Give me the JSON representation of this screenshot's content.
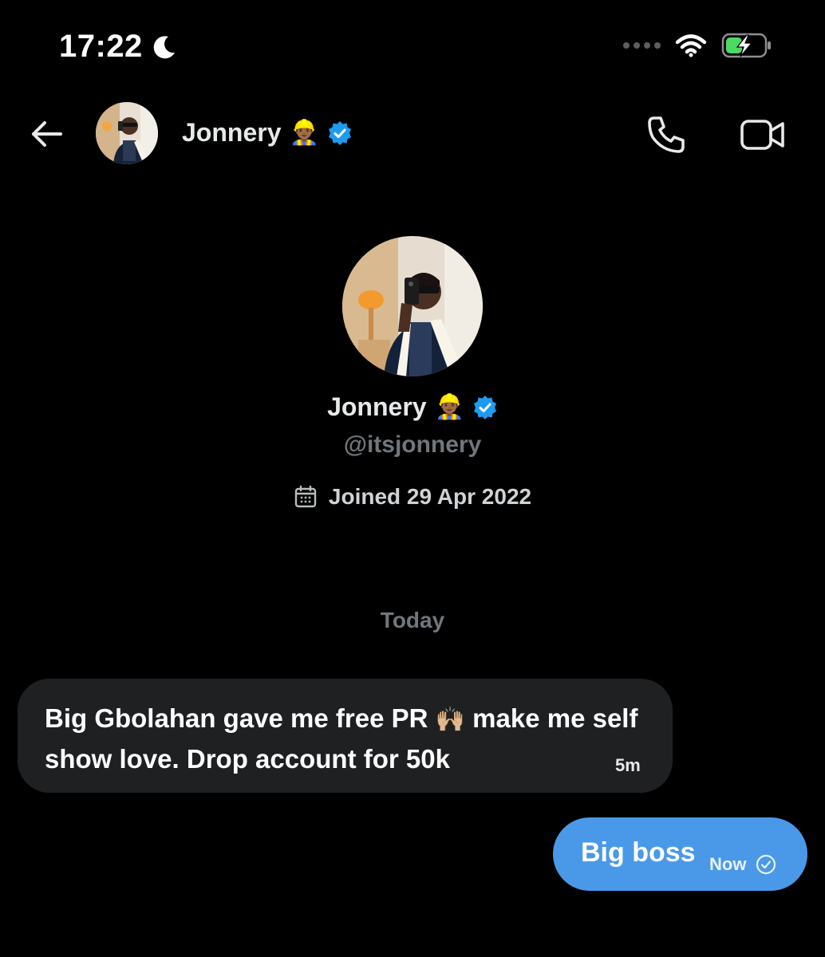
{
  "status_bar": {
    "time": "17:22",
    "icons": [
      "moon-icon",
      "signal-dots-icon",
      "wifi-icon",
      "battery-charging-icon"
    ],
    "battery_color": "#4cd964"
  },
  "header": {
    "back_icon": "arrow-left-icon",
    "name": "Jonnery",
    "emoji": "👷🏾‍♂️",
    "verified_icon": "verified-badge-icon",
    "call_icon": "phone-icon",
    "video_icon": "video-camera-icon"
  },
  "profile": {
    "name": "Jonnery",
    "emoji": "👷🏾‍♂️",
    "handle": "@itsjonnery",
    "joined": "Joined 29 Apr 2022",
    "calendar_icon": "calendar-icon"
  },
  "conversation": {
    "date_divider": "Today",
    "messages": [
      {
        "direction": "incoming",
        "text_part1": "Big Gbolahan gave me free PR ",
        "emoji": "🙌🏼",
        "text_part2": " make me self show love. Drop account for 50k",
        "time": "5m"
      },
      {
        "direction": "outgoing",
        "text": "Big boss",
        "time": "Now",
        "status_icon": "sent-check-icon"
      }
    ]
  },
  "colors": {
    "background": "#000000",
    "accent": "#4a99e9",
    "verified": "#1d9bf0",
    "muted_text": "#71767b",
    "incoming_bubble": "#1f2022"
  }
}
